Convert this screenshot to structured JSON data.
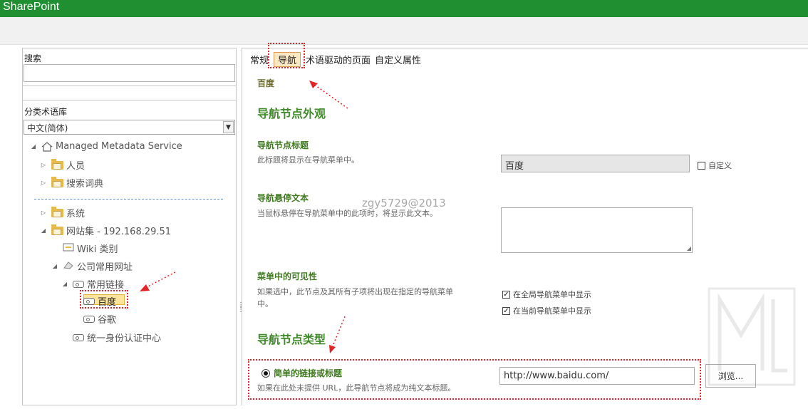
{
  "app": {
    "title": "SharePoint"
  },
  "left": {
    "search_label": "搜索",
    "search_value": "",
    "termstore_label": "分类术语库",
    "language": "中文(简体)",
    "tree": {
      "root": "Managed Metadata Service",
      "people": "人员",
      "search_dict": "搜索词典",
      "system": "系统",
      "site_collection": "网站集 - 192.168.29.51",
      "wiki": "Wiki 类别",
      "company_urls": "公司常用网址",
      "common_links": "常用链接",
      "baidu": "百度",
      "google": "谷歌",
      "sso": "统一身份认证中心"
    }
  },
  "tabs": [
    "常规",
    "导航",
    "术语驱动的页面",
    "自定义属性"
  ],
  "node_name": "百度",
  "appearance": {
    "section_title": "导航节点外观",
    "title_label": "导航节点标题",
    "title_desc": "此标题将显示在导航菜单中。",
    "title_value": "百度",
    "custom_label": "自定义",
    "hover_label": "导航悬停文本",
    "hover_desc": "当鼠标悬停在导航菜单中的此项时，将显示此文本。",
    "visibility_label": "菜单中的可见性",
    "visibility_desc_1": "如果选中，此节点及其所有子项将出现在指定的导航菜单",
    "visibility_desc_2": "中。",
    "global_nav": "在全局导航菜单中显示",
    "current_nav": "在当前导航菜单中显示"
  },
  "node_type": {
    "section_title": "导航节点类型",
    "simple_link_label": "简单的链接或标题",
    "simple_link_desc": "如果在此处未提供 URL，此导航节点将成为纯文本标题。",
    "url_value": "http://www.baidu.com/",
    "browse_label": "浏览..."
  },
  "watermark": "zgy5729@2013"
}
